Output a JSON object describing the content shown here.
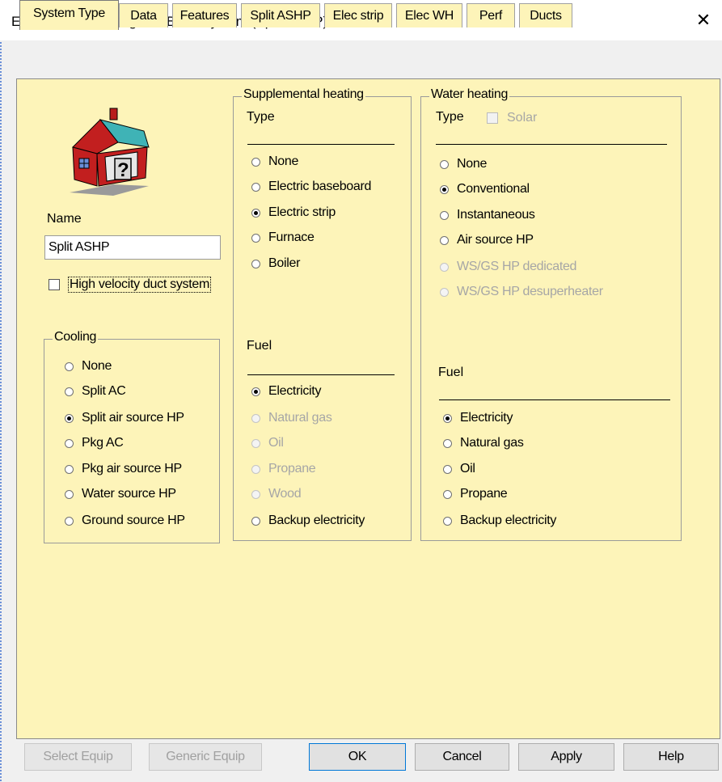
{
  "window": {
    "title": "Equipment for Living AH: Base System (Split ASHP)",
    "close_symbol": "✕"
  },
  "tabs": [
    {
      "label": "System Type",
      "active": true
    },
    {
      "label": "Data"
    },
    {
      "label": "Features"
    },
    {
      "label": "Split ASHP"
    },
    {
      "label": "Elec strip"
    },
    {
      "label": "Elec WH"
    },
    {
      "label": "Perf"
    },
    {
      "label": "Ducts"
    }
  ],
  "left": {
    "icon": "house-question-icon",
    "name_label": "Name",
    "name_value": "Split ASHP",
    "high_velocity_label": "High velocity duct system",
    "high_velocity_checked": false,
    "cooling": {
      "legend": "Cooling",
      "options": [
        "None",
        "Split AC",
        "Split air source HP",
        "Pkg AC",
        "Pkg air source HP",
        "Water source HP",
        "Ground source HP"
      ],
      "selected": 2
    }
  },
  "supplemental": {
    "legend": "Supplemental heating",
    "type_label": "Type",
    "type_options": [
      "None",
      "Electric baseboard",
      "Electric strip",
      "Furnace",
      "Boiler"
    ],
    "type_selected": 2,
    "fuel_label": "Fuel",
    "fuel_options": [
      "Electricity",
      "Natural gas",
      "Oil",
      "Propane",
      "Wood",
      "Backup electricity"
    ],
    "fuel_disabled": [
      false,
      true,
      true,
      true,
      true,
      false
    ],
    "fuel_selected": 0
  },
  "water": {
    "legend": "Water heating",
    "type_label": "Type",
    "solar_label": "Solar",
    "type_options": [
      "None",
      "Conventional",
      "Instantaneous",
      "Air source HP",
      "WS/GS HP dedicated",
      "WS/GS HP desuperheater"
    ],
    "type_disabled": [
      false,
      false,
      false,
      false,
      true,
      true
    ],
    "type_selected": 1,
    "fuel_label": "Fuel",
    "fuel_options": [
      "Electricity",
      "Natural gas",
      "Oil",
      "Propane",
      "Backup electricity"
    ],
    "fuel_selected": 0
  },
  "buttons": {
    "select_equip": "Select Equip",
    "generic_equip": "Generic Equip",
    "ok": "OK",
    "cancel": "Cancel",
    "apply": "Apply",
    "help": "Help"
  },
  "colors": {
    "panel": "#fdf4b9",
    "chrome": "#f0f0f0"
  }
}
